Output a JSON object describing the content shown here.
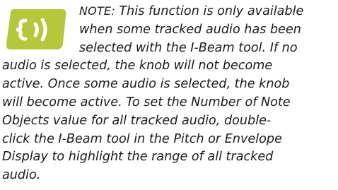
{
  "note": {
    "icon": "audio-waves-icon",
    "icon_color": "#b5c83b",
    "label": "NOTE:",
    "lines": [
      " This function is only available",
      "when some tracked audio has been",
      "selected with the I-Beam tool. If no",
      "audio is selected, the knob will not become",
      "active. Once some audio is selected, the knob",
      "will become active. To set the Number of Note",
      "Objects value for all tracked audio, double-",
      "click the I-Beam tool in the Pitch or Envelope",
      "Display to highlight the range of all tracked",
      "audio."
    ]
  }
}
